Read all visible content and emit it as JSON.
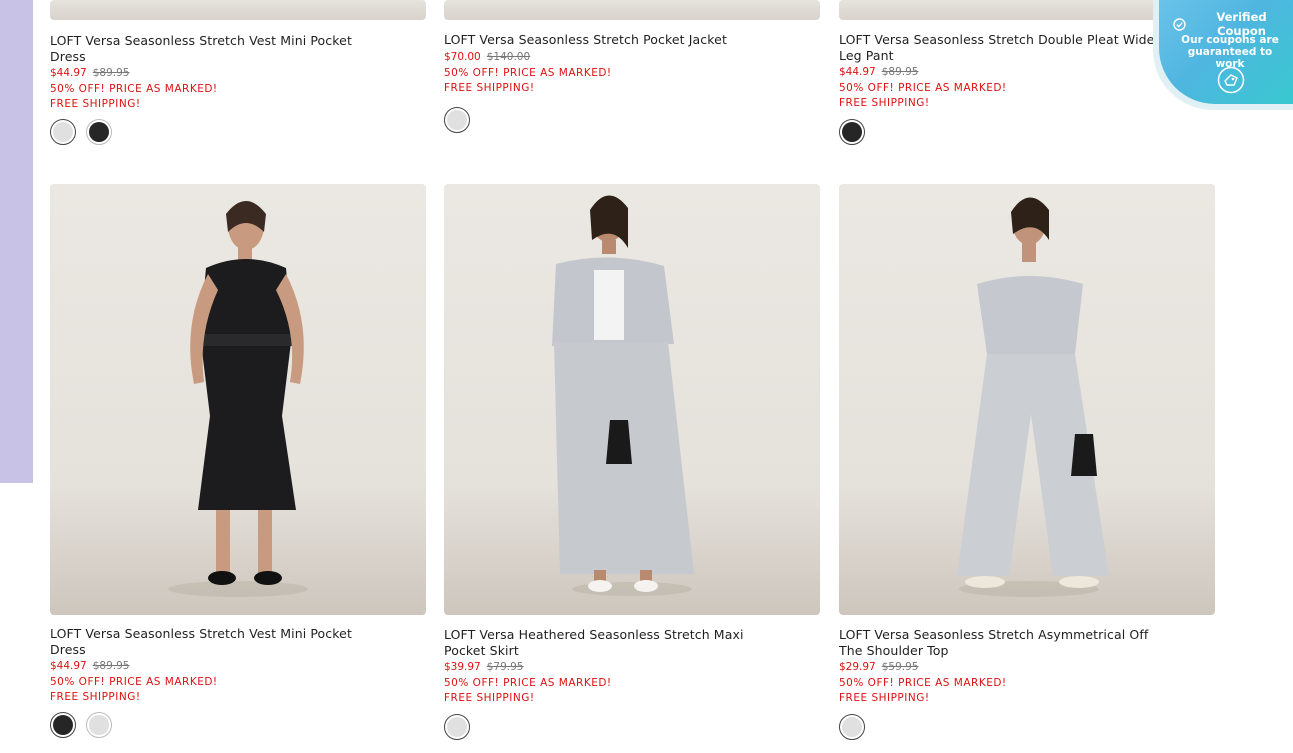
{
  "colors": {
    "price_red": "#dd1111",
    "side_strip": "#c7c2e6",
    "coupon_gradient": [
      "#6ac2e9",
      "#38c9cf"
    ],
    "swatch_light": "#e0e0e0",
    "swatch_dark": "#262626"
  },
  "coupon": {
    "title": "Verified Coupon",
    "text": "Our coupons are guaranteed to work",
    "icon": "check-badge-icon",
    "action_icon": "coupon-tag-icon"
  },
  "top_row": [
    {
      "title": "LOFT Versa Seasonless Stretch Vest Mini Pocket Dress",
      "price": "$44.97",
      "original_price": "$89.95",
      "promo": "50% OFF! PRICE AS MARKED!",
      "shipping": "FREE SHIPPING!",
      "swatches": [
        {
          "name": "light gray",
          "color": "#e0e0e0",
          "selected": true
        },
        {
          "name": "black",
          "color": "#262626",
          "selected": false
        }
      ]
    },
    {
      "title": "LOFT Versa Seasonless Stretch Pocket Jacket",
      "price": "$70.00",
      "original_price": "$140.00",
      "promo": "50% OFF! PRICE AS MARKED!",
      "shipping": "FREE SHIPPING!",
      "swatches": [
        {
          "name": "light gray",
          "color": "#e0e0e0",
          "selected": true
        }
      ]
    },
    {
      "title": "LOFT Versa Seasonless Stretch Double Pleat Wide Leg Pant",
      "price": "$44.97",
      "original_price": "$89.95",
      "promo": "50% OFF! PRICE AS MARKED!",
      "shipping": "FREE SHIPPING!",
      "swatches": [
        {
          "name": "black",
          "color": "#262626",
          "selected": true
        }
      ]
    }
  ],
  "bottom_row": [
    {
      "title": "LOFT Versa Seasonless Stretch Vest Mini Pocket Dress",
      "price": "$44.97",
      "original_price": "$89.95",
      "promo": "50% OFF! PRICE AS MARKED!",
      "shipping": "FREE SHIPPING!",
      "image": "black sleeveless vest mini dress",
      "swatches": [
        {
          "name": "black",
          "color": "#262626",
          "selected": true
        },
        {
          "name": "light gray",
          "color": "#e0e0e0",
          "selected": false
        }
      ]
    },
    {
      "title": "LOFT Versa Heathered Seasonless Stretch Maxi Pocket Skirt",
      "price": "$39.97",
      "original_price": "$79.95",
      "promo": "50% OFF! PRICE AS MARKED!",
      "shipping": "FREE SHIPPING!",
      "image": "gray cropped jacket and maxi skirt",
      "swatches": [
        {
          "name": "light gray",
          "color": "#e0e0e0",
          "selected": true
        }
      ]
    },
    {
      "title": "LOFT Versa Seasonless Stretch Asymmetrical Off The Shoulder Top",
      "price": "$29.97",
      "original_price": "$59.95",
      "promo": "50% OFF! PRICE AS MARKED!",
      "shipping": "FREE SHIPPING!",
      "image": "gray off the shoulder top and wide leg pant",
      "swatches": [
        {
          "name": "light gray",
          "color": "#e0e0e0",
          "selected": true
        }
      ]
    }
  ]
}
